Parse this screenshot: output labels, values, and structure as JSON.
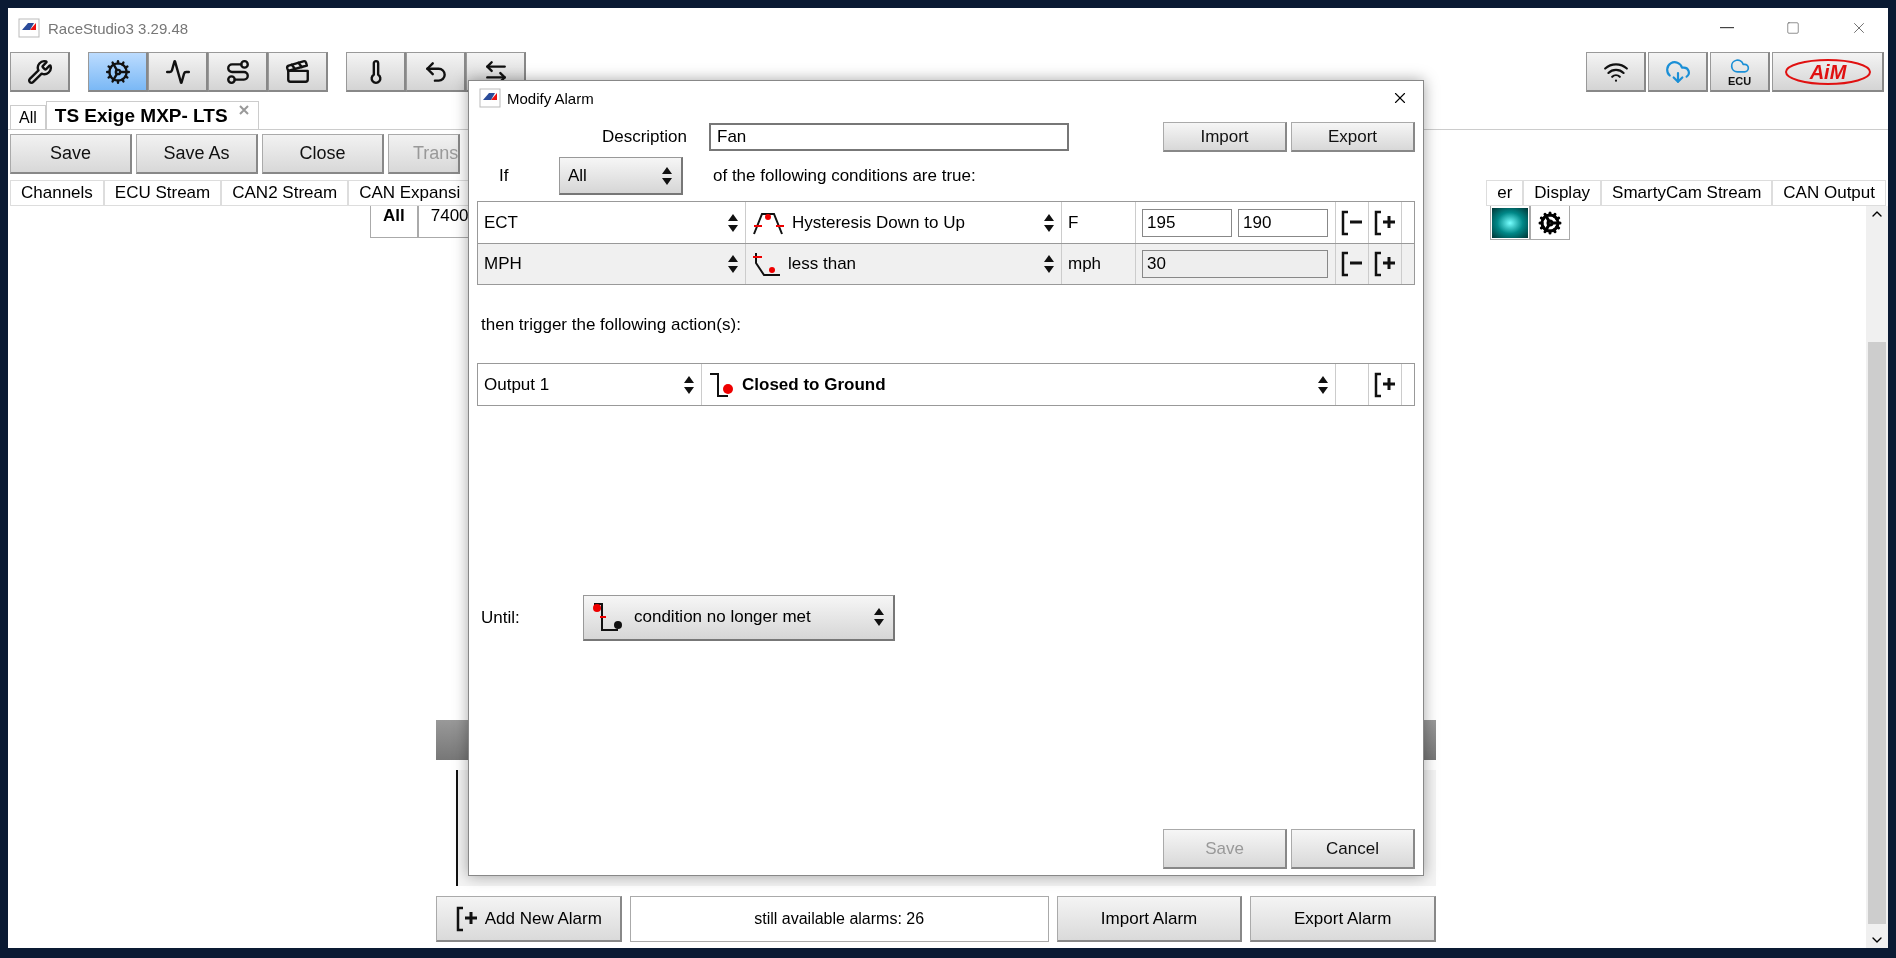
{
  "window": {
    "title": "RaceStudio3 3.29.48"
  },
  "toolbar": {
    "left": [
      {
        "kind": "wrench",
        "selected": false
      },
      {
        "kind": "gear",
        "selected": true
      },
      {
        "kind": "chart",
        "selected": false
      },
      {
        "kind": "track",
        "selected": false
      },
      {
        "kind": "video",
        "selected": false
      },
      {
        "kind": "temp",
        "selected": false
      },
      {
        "kind": "back",
        "selected": false
      },
      {
        "kind": "transfer",
        "selected": false
      }
    ],
    "right": [
      {
        "kind": "wifi"
      },
      {
        "kind": "cloud_download"
      },
      {
        "kind": "cloud_ecu",
        "label": "ECU"
      },
      {
        "kind": "logo",
        "label": "AiM"
      }
    ]
  },
  "doc_tabs": [
    {
      "label": "All",
      "selected": false
    },
    {
      "label": "TS Exige MXP- LTS",
      "selected": true
    }
  ],
  "actions": [
    {
      "label": "Save",
      "disabled": false
    },
    {
      "label": "Save As",
      "disabled": false
    },
    {
      "label": "Close",
      "disabled": false
    },
    {
      "label": "Trans",
      "disabled": true
    }
  ],
  "channel_tabs_left": [
    "Channels",
    "ECU Stream",
    "CAN2 Stream",
    "CAN Expansi"
  ],
  "channel_tabs_right": [
    "er",
    "Display",
    "SmartyCam Stream",
    "CAN Output"
  ],
  "table_header": [
    "All",
    "7400"
  ],
  "dialog": {
    "title": "Modify Alarm",
    "description_label": "Description",
    "description": "Fan",
    "import": "Import",
    "export": "Export",
    "if_label": "If",
    "mode": "All",
    "condition_text": "of the following conditions are true:",
    "conditions": [
      {
        "channel": "ECT",
        "kind": "hysteresis",
        "operator": "Hysteresis Down to Up",
        "unit": "F",
        "values": [
          "195",
          "190"
        ]
      },
      {
        "channel": "MPH",
        "kind": "less_than",
        "operator": "less than",
        "unit": "mph",
        "values": [
          "30"
        ]
      }
    ],
    "then_text": "then trigger the following action(s):",
    "actions": [
      {
        "output": "Output 1",
        "kind": "closed_to_ground",
        "mode": "Closed to Ground"
      }
    ],
    "until_label": "Until:",
    "until": "condition no longer met",
    "footer": [
      {
        "label": "Save",
        "disabled": true
      },
      {
        "label": "Cancel",
        "disabled": false
      }
    ]
  },
  "bottom": {
    "add": "Add New Alarm",
    "counter": "still available alarms: 26",
    "import": "Import Alarm",
    "export": "Export Alarm"
  }
}
